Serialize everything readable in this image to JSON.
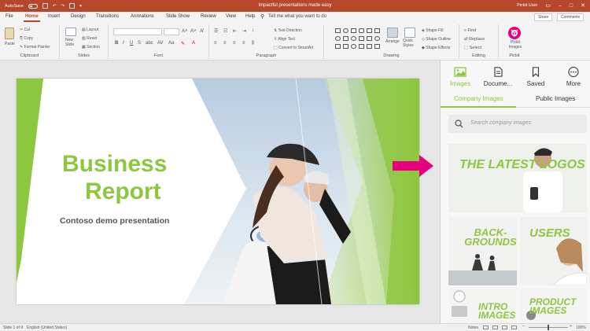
{
  "titlebar": {
    "autosave": "AutoSave",
    "autosave_state": "Off",
    "document_title": "Impactful presentations made easy",
    "user": "Pickit User"
  },
  "tabs": [
    "File",
    "Home",
    "Insert",
    "Design",
    "Transitions",
    "Animations",
    "Slide Show",
    "Review",
    "View",
    "Help"
  ],
  "active_tab": "Home",
  "tell_me": "Tell me what you want to do",
  "share_label": "Share",
  "comments_label": "Comments",
  "ribbon": {
    "clipboard": {
      "label": "Clipboard",
      "paste": "Paste",
      "cut": "Cut",
      "copy": "Copy",
      "format_painter": "Format Painter"
    },
    "slides": {
      "label": "Slides",
      "new_slide": "New Slide",
      "layout": "Layout",
      "reset": "Reset",
      "section": "Section"
    },
    "font": {
      "label": "Font"
    },
    "paragraph": {
      "label": "Paragraph",
      "text_direction": "Text Direction",
      "align_text": "Align Text",
      "convert_smartart": "Convert to SmartArt"
    },
    "drawing": {
      "label": "Drawing",
      "arrange": "Arrange",
      "quick_styles": "Quick Styles",
      "shape_fill": "Shape Fill",
      "shape_outline": "Shape Outline",
      "shape_effects": "Shape Effects"
    },
    "editing": {
      "label": "Editing",
      "find": "Find",
      "replace": "Replace",
      "select": "Select"
    },
    "pickit": {
      "label": "Pickit",
      "button": "Pickit Images"
    }
  },
  "slide": {
    "title_line1": "Business",
    "title_line2": "Report",
    "subtitle": "Contoso demo presentation"
  },
  "pane": {
    "nav": [
      {
        "label": "Images",
        "icon": "image-icon"
      },
      {
        "label": "Docume...",
        "icon": "document-icon"
      },
      {
        "label": "Saved",
        "icon": "bookmark-icon"
      },
      {
        "label": "More",
        "icon": "more-icon"
      }
    ],
    "active_nav": "Images",
    "subtabs": [
      "Company Images",
      "Public Images"
    ],
    "active_subtab": "Company Images",
    "search_placeholder": "Search company images",
    "tiles": [
      {
        "text": "The latest logos"
      },
      {
        "text": "Back-grounds"
      },
      {
        "text": "Users"
      },
      {
        "text": "Intro images"
      },
      {
        "text": "Product images"
      }
    ]
  },
  "status": {
    "slide": "Slide 1 of 9",
    "language": "English (United States)",
    "notes": "Notes",
    "zoom": "100%"
  },
  "colors": {
    "accent": "#b7472a",
    "pickit_green": "#8dc63f",
    "pickit_pink": "#e6007e"
  }
}
